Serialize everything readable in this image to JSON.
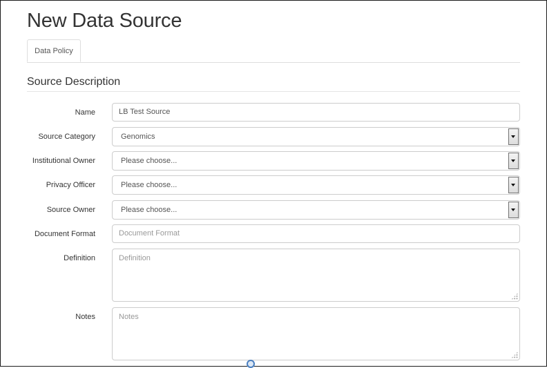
{
  "page": {
    "title": "New Data Source"
  },
  "tabs": [
    {
      "label": "Data Policy"
    }
  ],
  "section": {
    "title": "Source Description"
  },
  "form": {
    "name": {
      "label": "Name",
      "value": "LB Test Source"
    },
    "source_category": {
      "label": "Source Category",
      "value": "Genomics"
    },
    "institutional_owner": {
      "label": "Institutional Owner",
      "value": "Please choose..."
    },
    "privacy_officer": {
      "label": "Privacy Officer",
      "value": "Please choose..."
    },
    "source_owner": {
      "label": "Source Owner",
      "value": "Please choose..."
    },
    "document_format": {
      "label": "Document Format",
      "placeholder": "Document Format"
    },
    "definition": {
      "label": "Definition",
      "placeholder": "Definition"
    },
    "notes": {
      "label": "Notes",
      "placeholder": "Notes"
    }
  },
  "icons": {
    "select_arrow": "chevron-down-icon",
    "resize": "resize-grip-icon",
    "loading": "loading-spinner-icon"
  },
  "colors": {
    "border": "#cccccc",
    "text": "#333333",
    "placeholder": "#999999"
  }
}
